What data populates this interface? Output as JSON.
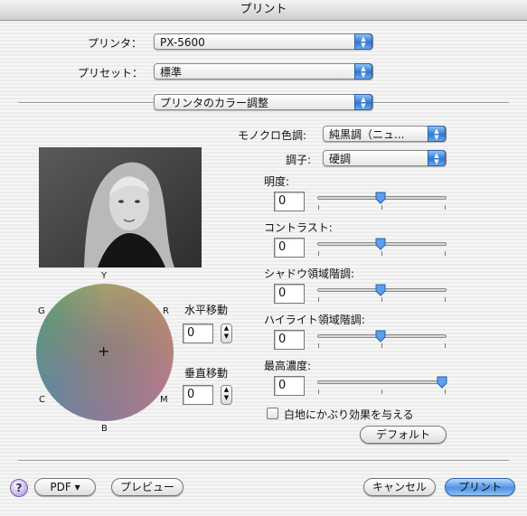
{
  "window": {
    "title": "プリント"
  },
  "printer": {
    "label": "プリンタ：",
    "value": "PX-5600"
  },
  "preset": {
    "label": "プリセット：",
    "value": "標準"
  },
  "panel": {
    "value": "プリンタのカラー調整"
  },
  "mono_tone": {
    "label": "モノクロ色調:",
    "value": "純黒調（ニュ..."
  },
  "tone": {
    "label": "調子:",
    "value": "硬調"
  },
  "sliders": [
    {
      "label": "明度:",
      "value": "0",
      "fraction": 0.5
    },
    {
      "label": "コントラスト:",
      "value": "0",
      "fraction": 0.5
    },
    {
      "label": "シャドウ領域階調:",
      "value": "0",
      "fraction": 0.5
    },
    {
      "label": "ハイライト領域階調:",
      "value": "0",
      "fraction": 0.5
    },
    {
      "label": "最高濃度:",
      "value": "0",
      "fraction": 1.0
    }
  ],
  "color_wheel": {
    "labels": {
      "Y": "Y",
      "R": "R",
      "M": "M",
      "B": "B",
      "C": "C",
      "G": "G"
    },
    "center_mark": "+"
  },
  "horizontal_move": {
    "label": "水平移動",
    "value": "0"
  },
  "vertical_move": {
    "label": "垂直移動",
    "value": "0"
  },
  "checkbox": {
    "label": "白地にかぶり効果を与える",
    "checked": false
  },
  "buttons": {
    "default": "デフォルト",
    "help": "?",
    "pdf": "PDF ▾",
    "preview": "プレビュー",
    "cancel": "キャンセル",
    "print": "プリント"
  },
  "colors": {
    "accent": "#4f93e3",
    "help": "#c9b8ea"
  }
}
